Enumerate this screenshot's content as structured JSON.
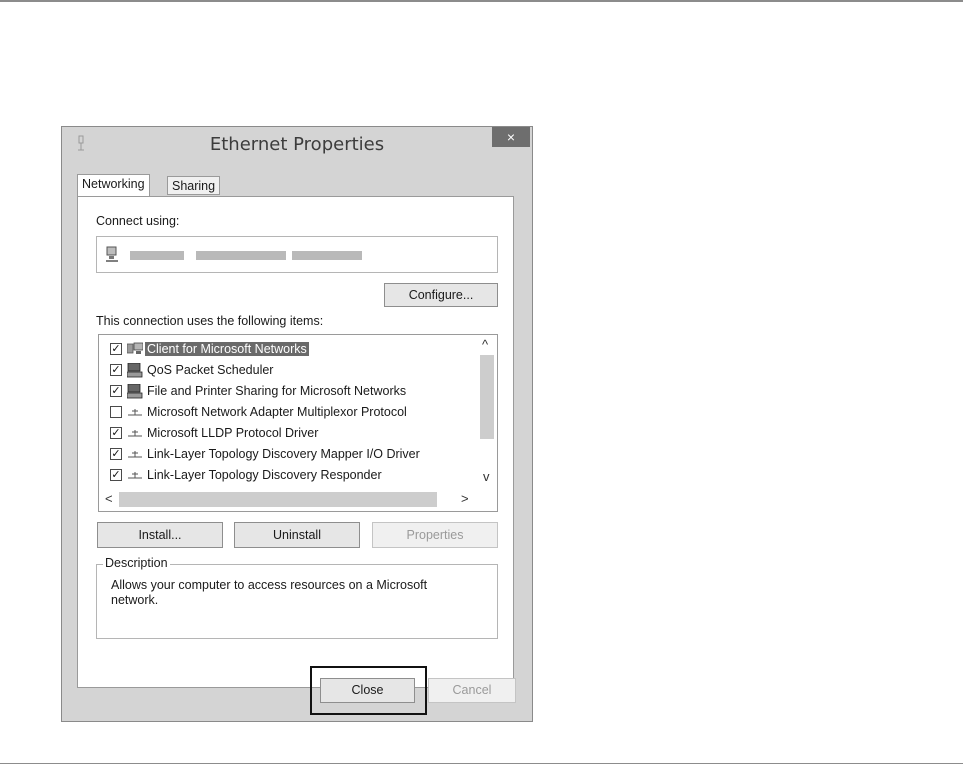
{
  "window": {
    "title": "Ethernet Properties",
    "close_glyph": "×"
  },
  "tabs": [
    {
      "label": "Networking",
      "active": true
    },
    {
      "label": "Sharing",
      "active": false
    }
  ],
  "connect_using_label": "Connect using:",
  "configure_label": "Configure...",
  "items_label": "This connection uses the following items:",
  "items": [
    {
      "label": "Client for Microsoft Networks",
      "checked": true,
      "icon": "network-client-icon",
      "selected": true
    },
    {
      "label": "QoS Packet Scheduler",
      "checked": true,
      "icon": "computer-service-icon",
      "selected": false
    },
    {
      "label": "File and Printer Sharing for Microsoft Networks",
      "checked": true,
      "icon": "computer-service-icon",
      "selected": false
    },
    {
      "label": "Microsoft Network Adapter Multiplexor Protocol",
      "checked": false,
      "icon": "protocol-icon",
      "selected": false
    },
    {
      "label": "Microsoft LLDP Protocol Driver",
      "checked": true,
      "icon": "protocol-icon",
      "selected": false
    },
    {
      "label": "Link-Layer Topology Discovery Mapper I/O Driver",
      "checked": true,
      "icon": "protocol-icon",
      "selected": false
    },
    {
      "label": "Link-Layer Topology Discovery Responder",
      "checked": true,
      "icon": "protocol-icon",
      "selected": false
    }
  ],
  "scroll": {
    "up": "^",
    "down": "v",
    "left": "<",
    "right": ">"
  },
  "buttons": {
    "install": "Install...",
    "uninstall": "Uninstall",
    "properties": "Properties",
    "close": "Close",
    "cancel": "Cancel"
  },
  "description": {
    "legend": "Description",
    "text": "Allows your computer to access resources on a Microsoft network."
  }
}
